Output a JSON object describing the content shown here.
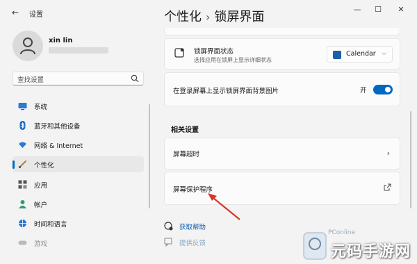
{
  "app": {
    "title": "设置"
  },
  "window_controls": {
    "minimize": "—",
    "maximize": "☐",
    "close": "✕"
  },
  "user": {
    "name": "xin lin"
  },
  "search": {
    "placeholder": "查找设置"
  },
  "nav": [
    {
      "label": "系统",
      "icon": "monitor-icon",
      "selected": false
    },
    {
      "label": "蓝牙和其他设备",
      "icon": "bluetooth-icon",
      "selected": false
    },
    {
      "label": "网络 & Internet",
      "icon": "wifi-icon",
      "selected": false
    },
    {
      "label": "个性化",
      "icon": "brush-icon",
      "selected": true
    },
    {
      "label": "应用",
      "icon": "apps-icon",
      "selected": false
    },
    {
      "label": "帐户",
      "icon": "account-icon",
      "selected": false
    },
    {
      "label": "时间和语言",
      "icon": "globe-icon",
      "selected": false
    },
    {
      "label": "游戏",
      "icon": "gamepad-icon",
      "selected": false
    }
  ],
  "breadcrumb": {
    "parent": "个性化",
    "separator": "›",
    "current": "锁屏界面"
  },
  "main": {
    "status": {
      "title": "锁屏界面状态",
      "desc": "选择应用在锁屏上显示详细状态",
      "value": "Calendar"
    },
    "background_toggle": {
      "title": "在登录屏幕上显示锁屏界面背景图片",
      "state_label": "开",
      "on": true
    },
    "related_section": "相关设置",
    "screen_timeout": {
      "title": "屏幕超时"
    },
    "screen_saver": {
      "title": "屏幕保护程序"
    }
  },
  "help": {
    "get_help": "获取帮助",
    "feedback": "提供反馈"
  },
  "watermark": {
    "small": "PConline",
    "brand": "元码手游网"
  },
  "colors": {
    "accent": "#0067c0",
    "background": "#f3f3f3",
    "card": "#fbfbfb",
    "link": "#0b5cad"
  }
}
